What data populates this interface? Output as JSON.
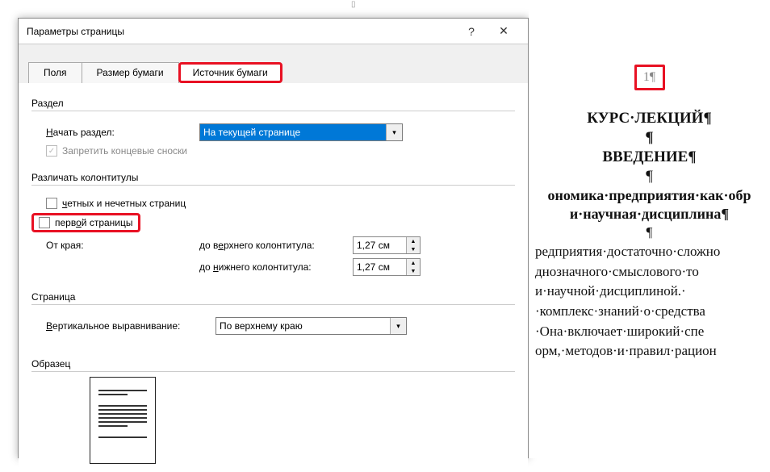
{
  "dialog": {
    "title": "Параметры страницы",
    "help": "?",
    "close": "✕",
    "tabs": {
      "fields": "Поля",
      "size": "Размер бумаги",
      "source": "Источник бумаги"
    },
    "section": {
      "label": "Раздел",
      "start_label": "Начать раздел:",
      "start_value": "На текущей странице",
      "endnotes": "Запретить концевые сноски"
    },
    "headers": {
      "label": "Различать колонтитулы",
      "odd_even": "четных и нечетных страниц",
      "first_page": "первой страницы",
      "from_edge": "От края:",
      "to_header": "до верхнего колонтитула:",
      "to_footer": "до нижнего колонтитула:",
      "header_val": "1,27 см",
      "footer_val": "1,27 см"
    },
    "page": {
      "label": "Страница",
      "valign_label": "Вертикальное выравнивание:",
      "valign_value": "По верхнему краю"
    },
    "sample": {
      "label": "Образец"
    }
  },
  "document": {
    "page_num": "1¶",
    "h1": "КУРС·ЛЕКЦИЙ¶",
    "p1": "¶",
    "h2": "ВВЕДЕНИЕ¶",
    "p2": "¶",
    "sub1": "ономика·предприятия·как·обр",
    "sub2": "и·научная·дисциплина¶",
    "p3": "¶",
    "body1": "редприятия·достаточно·сложно",
    "body2": "днозначного·смыслового·то",
    "body3": "и·научной·дисциплиной.·",
    "body4": "·комплекс·знаний·о·средства",
    "body5": "·Она·включает·широкий·спе",
    "body6": "орм,·методов·и·правил·рацион"
  }
}
